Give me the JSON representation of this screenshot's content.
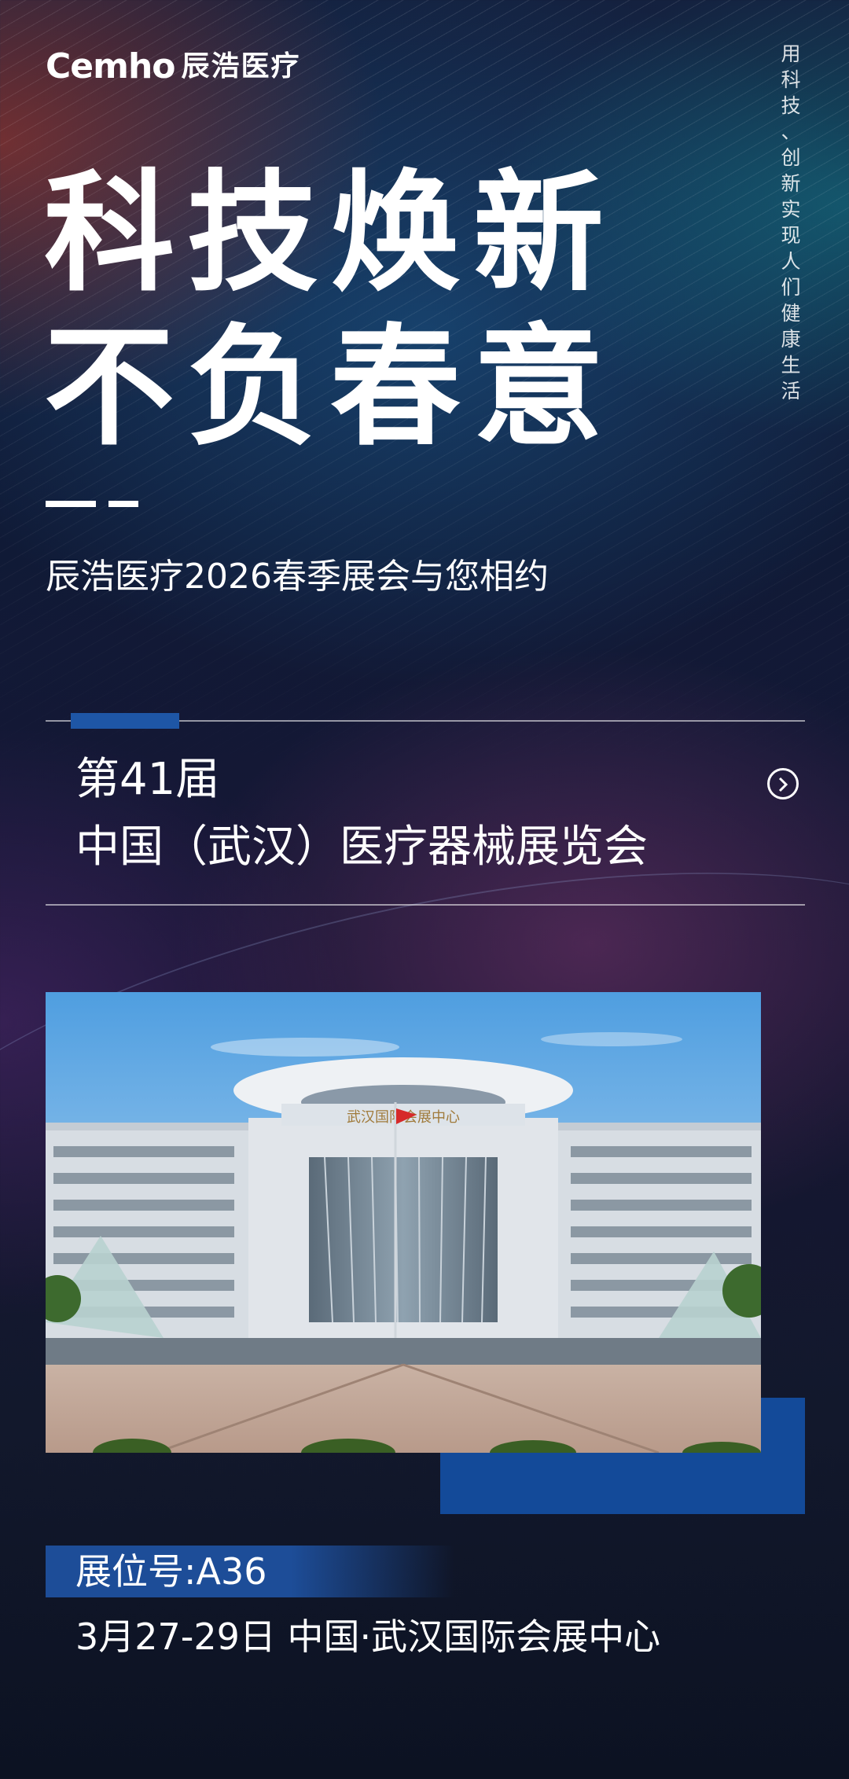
{
  "brand": {
    "logo_text": "emho",
    "logo_c": "C",
    "name_cn": "辰浩医疗"
  },
  "slogan_vertical": [
    "用",
    "科",
    "技",
    "、",
    "创",
    "新",
    "实",
    "现",
    "人",
    "们",
    "健",
    "康",
    "生",
    "活"
  ],
  "headline": {
    "line1": "科技焕新",
    "line2": "不负春意"
  },
  "subtitle": "辰浩医疗2026春季展会与您相约",
  "event": {
    "edition": "第41届",
    "name": "中国（武汉）医疗器械展览会"
  },
  "booth": "展位号:A36",
  "date_venue": "3月27-29日 中国·武汉国际会展中心",
  "photo": {
    "signage": "武汉国际会展中心"
  },
  "colors": {
    "accent_blue": "#1e56a6",
    "background_dark": "#12182c"
  }
}
